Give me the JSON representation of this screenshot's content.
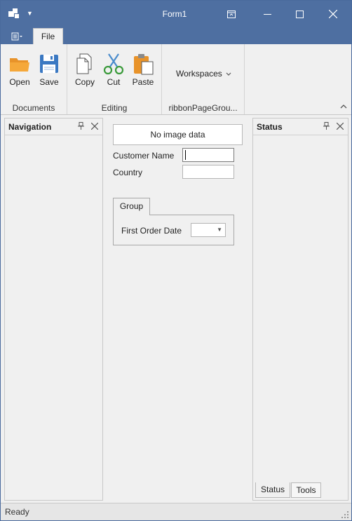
{
  "window": {
    "title": "Form1"
  },
  "ribbon": {
    "tabs": [
      {
        "label": "File"
      }
    ],
    "groups": [
      {
        "caption": "Documents",
        "buttons": [
          {
            "label": "Open",
            "icon": "folder-open-icon"
          },
          {
            "label": "Save",
            "icon": "floppy-disk-icon"
          }
        ]
      },
      {
        "caption": "Editing",
        "buttons": [
          {
            "label": "Copy",
            "icon": "copy-icon"
          },
          {
            "label": "Cut",
            "icon": "scissors-icon"
          },
          {
            "label": "Paste",
            "icon": "paste-icon"
          }
        ]
      },
      {
        "caption": "ribbonPageGrou...",
        "dropdown_label": "Workspaces"
      }
    ]
  },
  "navigation_panel": {
    "title": "Navigation"
  },
  "status_panel": {
    "title": "Status",
    "tabs": [
      {
        "label": "Status",
        "active": true
      },
      {
        "label": "Tools",
        "active": false
      }
    ]
  },
  "form": {
    "image_placeholder": "No image data",
    "customer_name_label": "Customer Name",
    "customer_name_value": "",
    "country_label": "Country",
    "country_value": "",
    "group_title": "Group",
    "first_order_date_label": "First Order Date",
    "first_order_date_value": ""
  },
  "statusbar": {
    "text": "Ready"
  },
  "colors": {
    "title_bar": "#4e6fa1",
    "ribbon_background": "#f0f0f0",
    "folder_orange": "#f0a030",
    "save_blue": "#3a78c2",
    "cut_green": "#3a9a3a"
  }
}
